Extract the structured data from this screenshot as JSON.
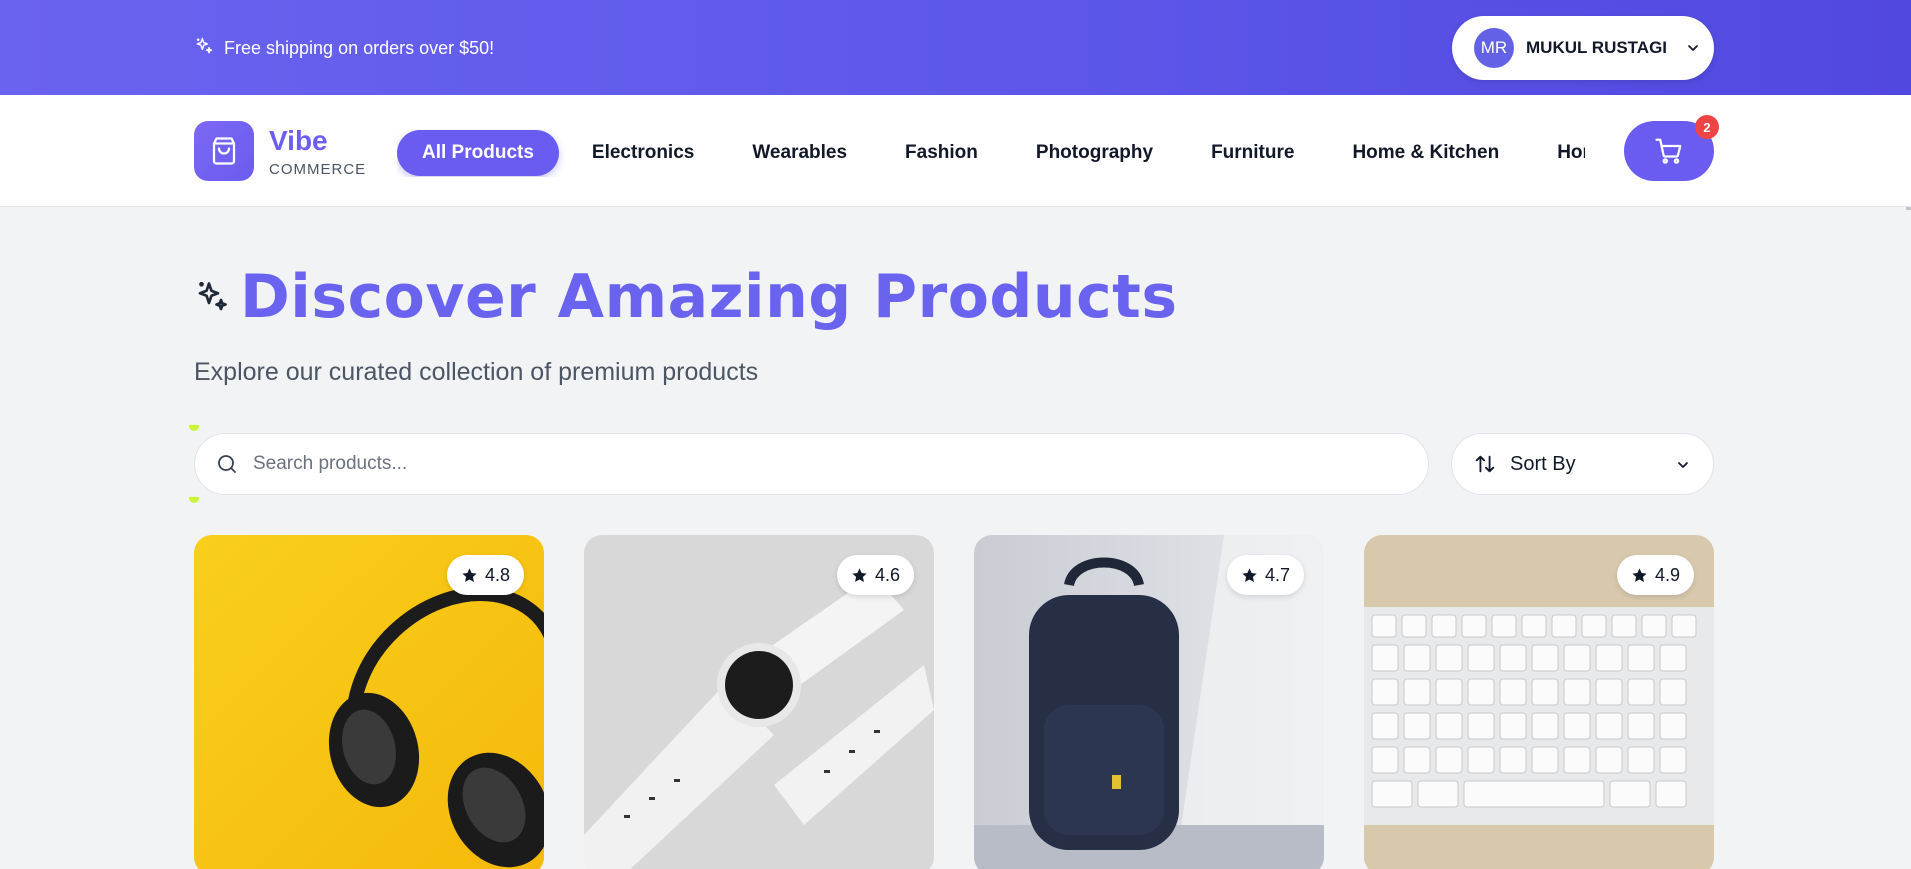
{
  "promo": {
    "message": "Free shipping on orders over $50!",
    "icon": "sparkles-icon"
  },
  "user": {
    "initials": "MR",
    "name": "MUKUL RUSTAGI",
    "icon": "chevron-down-icon"
  },
  "brand": {
    "name": "Vibe",
    "tagline": "COMMERCE",
    "icon": "shopping-bag-icon"
  },
  "categories": [
    {
      "label": "All Products",
      "active": true
    },
    {
      "label": "Electronics"
    },
    {
      "label": "Wearables"
    },
    {
      "label": "Fashion"
    },
    {
      "label": "Photography"
    },
    {
      "label": "Furniture"
    },
    {
      "label": "Home & Kitchen"
    },
    {
      "label": "Home"
    }
  ],
  "cart": {
    "count": "2",
    "icon": "cart-icon"
  },
  "hero": {
    "title": "Discover Amazing Products",
    "subtitle": "Explore our curated collection of premium products"
  },
  "search": {
    "placeholder": "Search products...",
    "value": ""
  },
  "sort": {
    "label": "Sort By"
  },
  "products": [
    {
      "rating": "4.8",
      "image": "headphones"
    },
    {
      "rating": "4.6",
      "image": "smartwatch"
    },
    {
      "rating": "4.7",
      "image": "backpack"
    },
    {
      "rating": "4.9",
      "image": "keyboard"
    }
  ],
  "colors": {
    "primary": "#6a5cf0",
    "promo_bg": "#5c55e8",
    "badge": "#ef4444"
  }
}
